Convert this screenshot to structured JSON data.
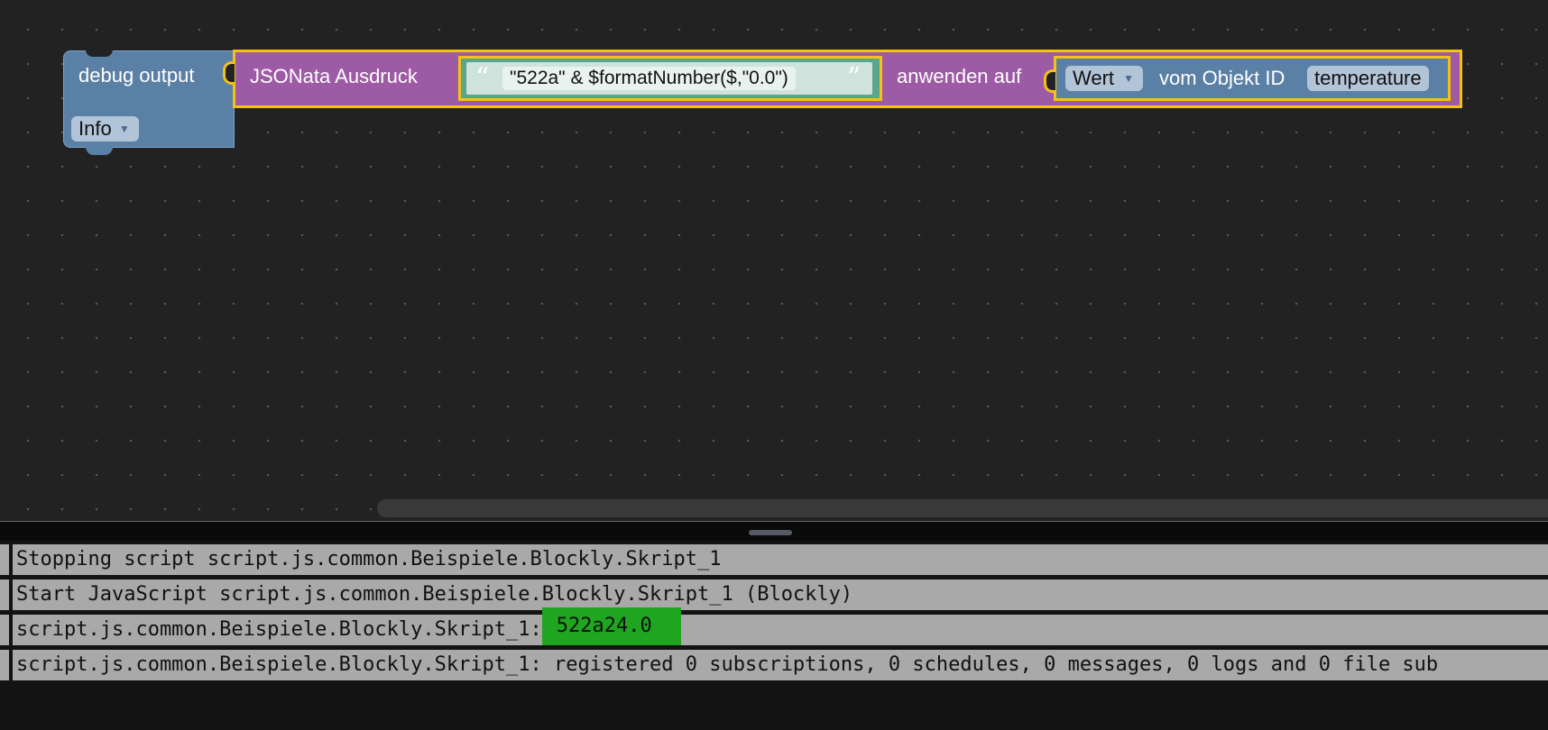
{
  "workspace": {
    "debug_block": {
      "label": "debug output",
      "level_dropdown": "Info"
    },
    "jsonata_block": {
      "label": "JSONata Ausdruck",
      "expression": "\"522a\" & $formatNumber($,\"0.0\")",
      "apply_label": "anwenden auf"
    },
    "get_value_block": {
      "attribute_dropdown": "Wert",
      "object_label": "vom Objekt ID",
      "object_id": "temperature"
    },
    "quote_open": "“",
    "quote_close": "”",
    "dropdown_arrow": "▼"
  },
  "log": {
    "lines": [
      "Stopping script script.js.common.Beispiele.Blockly.Skript_1",
      "Start JavaScript script.js.common.Beispiele.Blockly.Skript_1 (Blockly)",
      "script.js.common.Beispiele.Blockly.Skript_1:",
      "script.js.common.Beispiele.Blockly.Skript_1: registered 0 subscriptions, 0 schedules, 0 messages, 0 logs and 0 file sub"
    ],
    "highlighted_value": "522a24.0"
  },
  "colors": {
    "workspace_bg": "#222222",
    "text_block": "#5ba58c",
    "jsonata_block": "#9e5ba5",
    "debug_block": "#5b80a5",
    "selection": "#f5c211",
    "log_line_bg": "#a9a9a9",
    "highlight": "#1fa51f"
  }
}
